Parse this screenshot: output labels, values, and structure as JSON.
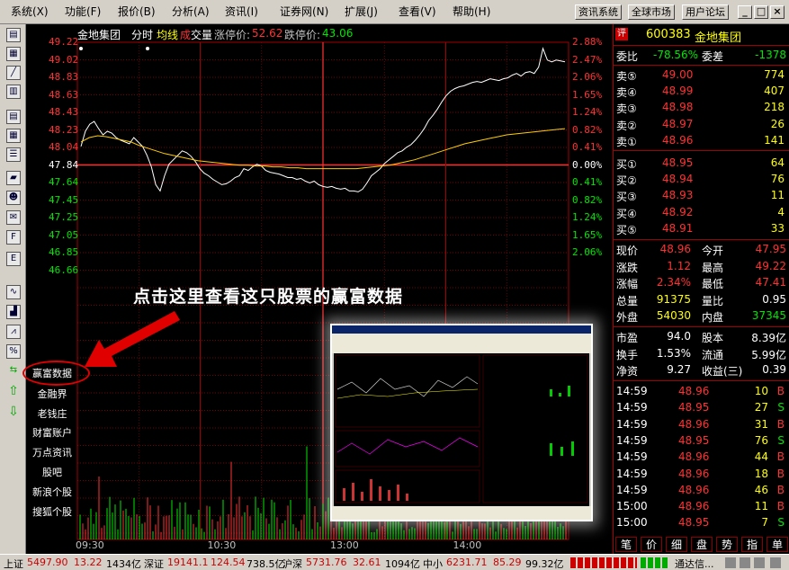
{
  "menubar": {
    "items": [
      "系统(X)",
      "功能(F)",
      "报价(B)",
      "分析(A)",
      "资讯(I)",
      "证券网(N)",
      "扩展(J)",
      "查看(V)",
      "帮助(H)"
    ],
    "buttons": [
      "资讯系统",
      "全球市场",
      "用户论坛"
    ]
  },
  "header": {
    "stock_name": "金地集团",
    "mode": "分时",
    "avg_line": "均线",
    "vol_label_1": "成",
    "vol_label_2": "交量",
    "limit_up_label": "涨停价:",
    "limit_up": "52.62",
    "limit_down_label": "跌停价:",
    "limit_down": "43.06"
  },
  "chart_data": {
    "type": "line",
    "prev_close": 47.84,
    "y_labels_left": [
      "49.22",
      "49.02",
      "48.83",
      "48.63",
      "48.43",
      "48.23",
      "48.04",
      "47.84",
      "47.64",
      "47.45",
      "47.25",
      "47.05",
      "46.85",
      "46.66"
    ],
    "y_labels_right": [
      "2.88%",
      "2.47%",
      "2.06%",
      "1.65%",
      "1.24%",
      "0.82%",
      "0.41%",
      "0.00%",
      "0.41%",
      "0.82%",
      "1.24%",
      "1.65%",
      "2.06%"
    ],
    "x_labels": [
      "09:30",
      "10:30",
      "13:00",
      "14:00"
    ],
    "price": [
      48.05,
      48.22,
      48.3,
      48.33,
      48.25,
      48.18,
      48.22,
      48.2,
      48.15,
      48.12,
      48.1,
      48.08,
      48.15,
      48.1,
      48.05,
      47.95,
      47.82,
      47.62,
      47.55,
      47.72,
      47.85,
      47.9,
      47.95,
      48.0,
      47.98,
      47.94,
      47.88,
      47.8,
      47.75,
      47.72,
      47.68,
      47.65,
      47.62,
      47.63,
      47.66,
      47.7,
      47.72,
      47.8,
      47.78,
      47.82,
      47.85,
      47.83,
      47.78,
      47.76,
      47.75,
      47.74,
      47.72,
      47.7,
      47.7,
      47.68,
      47.69,
      47.66,
      47.64,
      47.66,
      47.62,
      47.6,
      47.59,
      47.6,
      47.58,
      47.57,
      47.58,
      47.55,
      47.55,
      47.54,
      47.57,
      47.64,
      47.72,
      47.76,
      47.8,
      47.86,
      47.9,
      47.94,
      47.98,
      48.0,
      48.04,
      48.07,
      48.12,
      48.18,
      48.25,
      48.34,
      48.4,
      48.47,
      48.55,
      48.62,
      48.67,
      48.7,
      48.72,
      48.73,
      48.75,
      48.77,
      48.78,
      48.77,
      48.79,
      48.81,
      48.8,
      48.79,
      48.81,
      48.82,
      48.85,
      48.87,
      48.84,
      48.88,
      48.89,
      48.87,
      48.94,
      49.15,
      49.02,
      49.0,
      49.02,
      49.01,
      49.0
    ],
    "avg": [
      48.1,
      48.15,
      48.17,
      48.16,
      48.14,
      48.12,
      48.1,
      48.06,
      48.03,
      48.0,
      47.97,
      47.95,
      47.93,
      47.91,
      47.89,
      47.88,
      47.87,
      47.86,
      47.85,
      47.84,
      47.84,
      47.83,
      47.83,
      47.82,
      47.82,
      47.81,
      47.81,
      47.8,
      47.8,
      47.8,
      47.8,
      47.8,
      47.8,
      47.8,
      47.81,
      47.82,
      47.83,
      47.84,
      47.86,
      47.88,
      47.9,
      47.93,
      47.96,
      47.99,
      48.02,
      48.05,
      48.08,
      48.1,
      48.12,
      48.14,
      48.16,
      48.18,
      48.19,
      48.2,
      48.21,
      48.22,
      48.23,
      48.24,
      48.25
    ]
  },
  "side_nav": {
    "items": [
      "赢富数据",
      "金融界",
      "老钱庄",
      "财富账户",
      "万点资讯",
      "股吧",
      "新浪个股",
      "搜狐个股"
    ]
  },
  "annotation": "点击这里查看这只股票的赢富数据",
  "panel": {
    "code": "600383",
    "name": "金地集团",
    "wb_label": "委比",
    "wb": "-78.56%",
    "wc_label": "委差",
    "wc": "-1378",
    "sells": [
      {
        "label": "卖⑤",
        "price": "49.00",
        "vol": "774"
      },
      {
        "label": "卖④",
        "price": "48.99",
        "vol": "407"
      },
      {
        "label": "卖③",
        "price": "48.98",
        "vol": "218"
      },
      {
        "label": "卖②",
        "price": "48.97",
        "vol": "26"
      },
      {
        "label": "卖①",
        "price": "48.96",
        "vol": "141"
      }
    ],
    "buys": [
      {
        "label": "买①",
        "price": "48.95",
        "vol": "64"
      },
      {
        "label": "买②",
        "price": "48.94",
        "vol": "76"
      },
      {
        "label": "买③",
        "price": "48.93",
        "vol": "11"
      },
      {
        "label": "买④",
        "price": "48.92",
        "vol": "4"
      },
      {
        "label": "买⑤",
        "price": "48.91",
        "vol": "33"
      }
    ],
    "stats": [
      {
        "l1": "现价",
        "v1": "48.96",
        "l2": "今开",
        "v2": "47.95"
      },
      {
        "l1": "涨跌",
        "v1": "1.12",
        "l2": "最高",
        "v2": "49.22"
      },
      {
        "l1": "涨幅",
        "v1": "2.34%",
        "l2": "最低",
        "v2": "47.41"
      },
      {
        "l1": "总量",
        "v1": "91375",
        "l2": "量比",
        "v2": "0.95"
      },
      {
        "l1": "外盘",
        "v1": "54030",
        "l2": "内盘",
        "v2": "37345"
      }
    ],
    "stats2": [
      {
        "l1": "市盈",
        "v1": "94.0",
        "l2": "股本",
        "v2": "8.39亿"
      },
      {
        "l1": "换手",
        "v1": "1.53%",
        "l2": "流通",
        "v2": "5.99亿"
      },
      {
        "l1": "净资",
        "v1": "9.27",
        "l2": "收益(三)",
        "v2": "0.39"
      }
    ],
    "ticks": [
      {
        "time": "14:59",
        "price": "48.96",
        "vol": "10",
        "side": "B"
      },
      {
        "time": "14:59",
        "price": "48.95",
        "vol": "27",
        "side": "S"
      },
      {
        "time": "14:59",
        "price": "48.96",
        "vol": "31",
        "side": "B"
      },
      {
        "time": "14:59",
        "price": "48.95",
        "vol": "76",
        "side": "S"
      },
      {
        "time": "14:59",
        "price": "48.96",
        "vol": "44",
        "side": "B"
      },
      {
        "time": "14:59",
        "price": "48.96",
        "vol": "18",
        "side": "B"
      },
      {
        "time": "14:59",
        "price": "48.96",
        "vol": "46",
        "side": "B"
      },
      {
        "time": "15:00",
        "price": "48.96",
        "vol": "11",
        "side": "B"
      },
      {
        "time": "15:00",
        "price": "48.95",
        "vol": "7",
        "side": "S"
      }
    ],
    "tabs": [
      "笔",
      "价",
      "细",
      "盘",
      "势",
      "指",
      "单"
    ]
  },
  "statusbar": {
    "sh_label": "上证",
    "sh_val": "5497.90",
    "sh_chg": "13.22",
    "sh_amt": "1434亿",
    "sz_label": "深证",
    "sz_val": "19141.1",
    "sz_chg": "124.54",
    "sz_amt": "738.5亿",
    "hs_label": "沪深",
    "hs_val": "5731.76",
    "hs_chg": "32.61",
    "hs_amt": "1094亿",
    "zx_label": "中小",
    "zx_val": "6231.71",
    "zx_chg": "85.29",
    "zx_amt": "99.32亿",
    "connect": "通达信..."
  },
  "colors": {
    "up": "#ff3232",
    "down": "#00e600",
    "price_line": "#ffffff",
    "avg_line": "#ffcc00",
    "grid": "#a00000",
    "label_yellow": "#ffff00"
  }
}
